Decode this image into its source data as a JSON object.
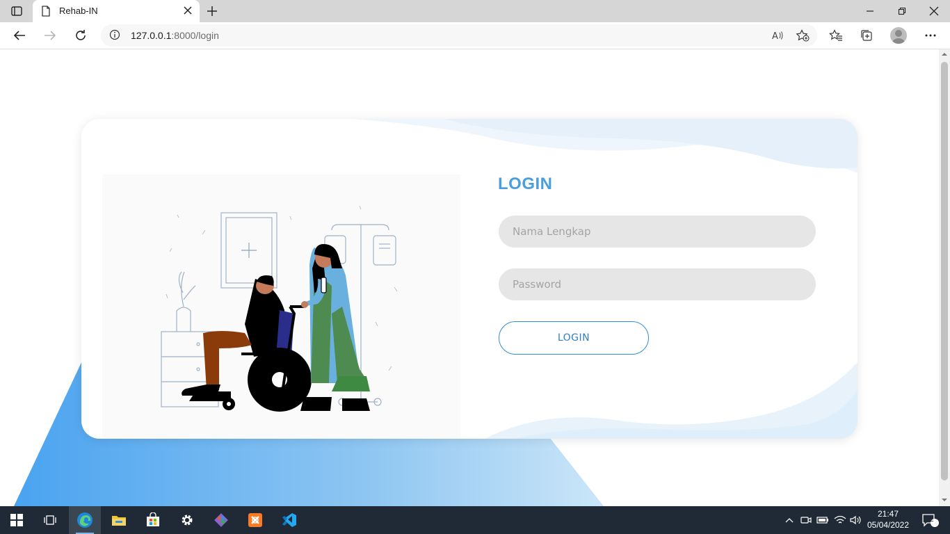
{
  "browser": {
    "tab_title": "Rehab-IN",
    "url_host": "127.0.0.1",
    "url_rest": ":8000/login"
  },
  "login": {
    "title": "LOGIN",
    "name_placeholder": "Nama Lengkap",
    "password_placeholder": "Password",
    "button_label": "LOGIN"
  },
  "taskbar": {
    "time": "21:47",
    "date": "05/04/2022",
    "notification_count": "2",
    "apps": [
      "start-icon",
      "task-view-icon",
      "edge-icon",
      "file-explorer-icon",
      "store-icon",
      "settings-icon",
      "git-icon",
      "xampp-icon",
      "vscode-icon"
    ]
  },
  "colors": {
    "accent": "#4a9ede",
    "field_bg": "#e6e6e6",
    "taskbar_bg": "#1f2a36"
  }
}
